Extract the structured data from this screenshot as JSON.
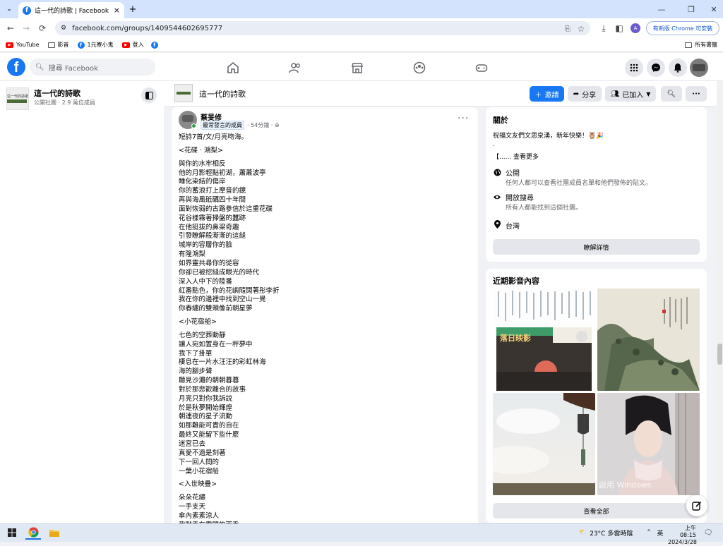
{
  "browser": {
    "tab_title": "這一代的詩歌 | Facebook",
    "tab_close": "×",
    "new_tab": "+",
    "url": "facebook.com/groups/1409544602695777",
    "update_button": "有新版 Chrome 可安裝",
    "profile_initial": "A",
    "bookmarks": [
      {
        "label": "YouTube",
        "icon": "youtube-icon"
      },
      {
        "label": "影音",
        "icon": "folder-icon"
      },
      {
        "label": "1元寮小鬼",
        "icon": "facebook-icon"
      },
      {
        "label": "登入",
        "icon": "youtube-icon"
      },
      {
        "label": "",
        "icon": "facebook-icon"
      }
    ],
    "all_bookmarks": "所有書籤"
  },
  "facebook": {
    "logo": "f",
    "search_placeholder": "搜尋 Facebook"
  },
  "group": {
    "name": "這一代的詩歌",
    "meta": "公開社團 · 2.9 萬位成員",
    "thumb_text": "這一代的詩歌",
    "buttons": {
      "invite": "邀請",
      "share": "分享",
      "joined": "已加入"
    }
  },
  "post": {
    "author": "蔡旻修",
    "badge": "最常發言的成員",
    "time": " · 54分鐘 ·",
    "lines": [
      "短詩7首/文/月亮吻海。",
      "",
      "<花碟 · 鴻梨>",
      "",
      "與你的水牢相反",
      "他的月影輕點初湖，蕭蕭波亭",
      "睡化染結的傷岸",
      "你的蓄浪打上摩音的鏡",
      "再與海風砥礪四十年間",
      "面對恢弱的古路參信於這重花碟",
      "花谷樣霧著掃盤的蠶跡",
      "在他挺拔的鼻梁奇趣",
      "引發瞭解般漸漸的這縫",
      "城岸的容層你的臉",
      "有隆鴻梨",
      "如界靈共尋你的從容",
      "你卻已被挖縫成眼光的時代",
      "深入人中下的陸番",
      "紅番點色，你的花嶼隨闊著彤李折",
      "我在你的邊裡中找到空山一覺",
      "你春纏的雙頰像前朝星夢",
      "",
      "<小花宿船>",
      "",
      "七色的空葬動靜",
      "讓人宛如置身在一秤夢中",
      "我下了掛單",
      "棲息在一片水汪汪的彩虹林海",
      "海的腳步聲",
      "聽見沙灘的朝朝暮暮",
      "對於那悲歡離合的故事",
      "月亮只對你我訴說",
      "於是秋夢開始輝煌",
      "朝連夜的星子流動",
      "如那難能可貴的自在",
      "最終又能留下些什麼",
      "迷宮已去",
      "真愛不過是刻著",
      "下一回人間的",
      "一葉小花宿船",
      "",
      "<入世映疊>",
      "",
      "朵朵花繡",
      "一手支天",
      "傘內素素涼人",
      "我默乘在雲間的雨季"
    ]
  },
  "about": {
    "title": "關於",
    "description": "祝福文友們文思泉湧，新年快樂！",
    "dot": ".",
    "see_more": "【...... 查看更多",
    "public_title": "公開",
    "public_desc": "任何人都可以查看社團成員名單和他們發佈的貼文。",
    "visible_title": "開放搜尋",
    "visible_desc": "所有人都能找到這個社團。",
    "location": "台灣",
    "details_button": "瞭解詳情"
  },
  "media": {
    "title": "近期影音內容",
    "view_all": "查看全部",
    "book_title": "落日映影",
    "watermark": "啟用 Windows"
  },
  "taskbar": {
    "weather": "23°C  多雲時陰",
    "ime": "英",
    "time": "上午 08:15",
    "date": "2024/3/28"
  }
}
